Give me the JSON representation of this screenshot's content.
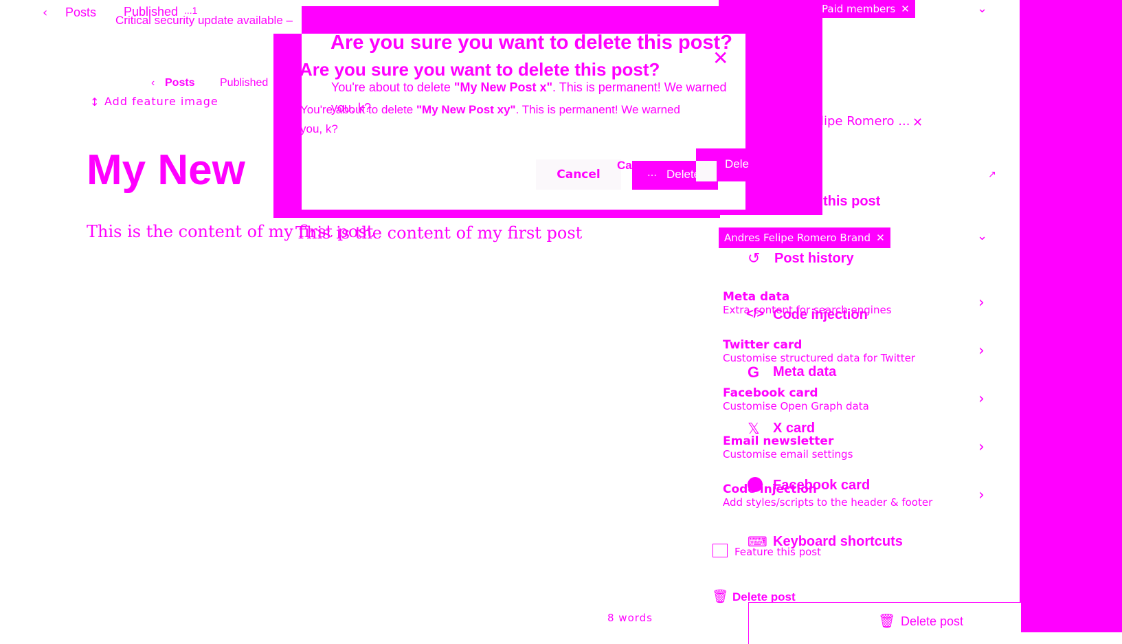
{
  "topbar": {
    "back_label": "Posts",
    "status": "Published",
    "status_suffix": "...1",
    "security_notice": "Critical security update available –"
  },
  "inner_header": {
    "back_label": "Posts",
    "status": "Published",
    "feature_image": "Add feature image"
  },
  "editor": {
    "title": "My New",
    "content": "This is the content of my first post",
    "content_overlay": "This is the content of my first post",
    "ghost_text": "first post",
    "word_count": "8 words"
  },
  "sidebar": {
    "tags": {
      "paid_members": "Paid members",
      "author_top": "lipe Romero ...",
      "author": "Andres Felipe Romero Brand"
    },
    "feature_label_fragment": "this post",
    "menu": [
      {
        "label": "Post history",
        "icon": "history-icon"
      },
      {
        "label": "Code injection",
        "icon": "code-icon"
      },
      {
        "label": "Meta data",
        "icon": "google-icon"
      },
      {
        "label": "X card",
        "icon": "x-icon"
      },
      {
        "label": "Facebook card",
        "icon": "facebook-icon"
      },
      {
        "label": "Keyboard shortcuts",
        "icon": "keyboard-icon"
      }
    ],
    "settings_rows": [
      {
        "title": "Meta data",
        "subtitle": "Extra content for search engines"
      },
      {
        "title": "Twitter card",
        "subtitle": "Customise structured data for Twitter"
      },
      {
        "title": "Facebook card",
        "subtitle": "Customise Open Graph data"
      },
      {
        "title": "Email newsletter",
        "subtitle": "Customise email settings"
      },
      {
        "title": "Code injection",
        "subtitle": "Add styles/scripts to the header & footer"
      }
    ],
    "feature_checkbox_label": "Feature this post",
    "delete_post_small": "Delete post",
    "delete_post_large": "Delete post"
  },
  "modal": {
    "title_back": "Are you sure you want to delete this post?",
    "title_front": "Are you sure you want to delete this post?",
    "body_back_prefix": "You're about to delete ",
    "body_back_name": "\"My New Post x\"",
    "body_back_suffix": ". This is permanent! We warned",
    "body_back_tail": "you, k?",
    "body_front_prefix": "You're about to delete ",
    "body_front_name": "\"My New Post xy\"",
    "body_front_suffix": ". This is permanent! We warned",
    "body_front_tail": "you, k?",
    "cancel_label": "Cancel",
    "cancel_ghost": "Ca",
    "delete_label": "Delete",
    "delete_ghost": "Dele"
  },
  "colors": {
    "accent": "#ff00ff",
    "background": "#ffffff"
  }
}
